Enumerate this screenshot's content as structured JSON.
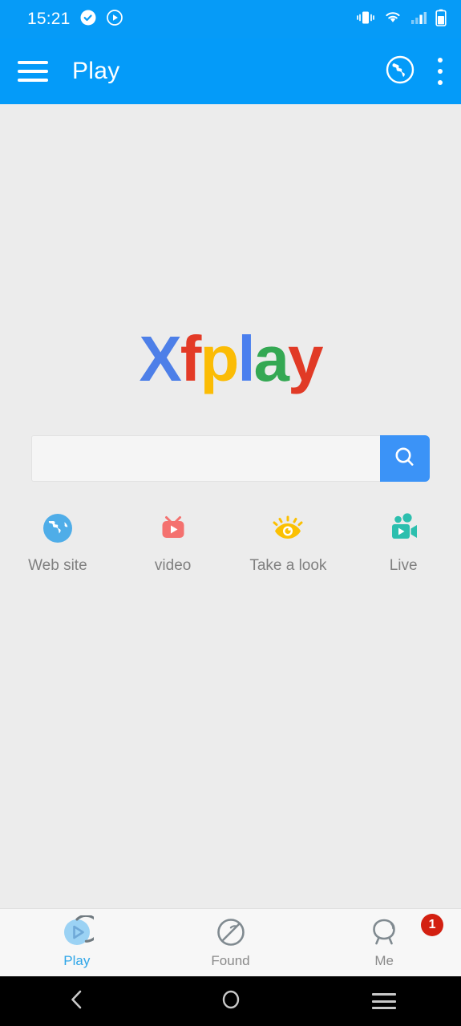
{
  "status_bar": {
    "time": "15:21",
    "left_icons": [
      "check-badge-icon",
      "play-circle-icon"
    ],
    "right_icons": [
      "vibrate-icon",
      "wifi-icon",
      "signal-icon",
      "battery-icon"
    ],
    "background": "#069BF7"
  },
  "app_bar": {
    "menu_icon": "hamburger-menu-icon",
    "title": "Play",
    "globe_icon": "globe-icon",
    "overflow_icon": "more-vertical-icon",
    "background": "#049BF9"
  },
  "logo": {
    "letters": [
      {
        "char": "X",
        "color": "#4D7FE8"
      },
      {
        "char": "f",
        "color": "#E33A26"
      },
      {
        "char": "p",
        "color": "#FBBC05"
      },
      {
        "char": "l",
        "color": "#4A7FEE"
      },
      {
        "char": "a",
        "color": "#34A853"
      },
      {
        "char": "y",
        "color": "#E13A26"
      }
    ],
    "text": "Xfplay"
  },
  "search": {
    "value": "",
    "placeholder": "",
    "button_icon": "search-icon",
    "button_color": "#3B93F7"
  },
  "shortcuts": [
    {
      "label": "Web site",
      "icon": "globe-icon",
      "color": "#4FADE8"
    },
    {
      "label": "video",
      "icon": "tv-play-icon",
      "color": "#F4716F"
    },
    {
      "label": "Take a look",
      "icon": "eye-icon",
      "color": "#FBC002"
    },
    {
      "label": "Live",
      "icon": "video-camera-people-icon",
      "color": "#2CBFAE"
    }
  ],
  "bottom_nav": {
    "items": [
      {
        "label": "Play",
        "icon": "play-circle-icon",
        "active": true,
        "badge": null
      },
      {
        "label": "Found",
        "icon": "compass-icon",
        "active": false,
        "badge": null
      },
      {
        "label": "Me",
        "icon": "person-icon",
        "active": false,
        "badge": "1"
      }
    ],
    "active_color": "#2FA6E8",
    "inactive_color": "#8A8A8A",
    "badge_color": "#D32011"
  },
  "android_nav": {
    "back_icon": "chevron-left-icon",
    "home_icon": "circle-icon",
    "recents_icon": "hamburger-icon"
  }
}
